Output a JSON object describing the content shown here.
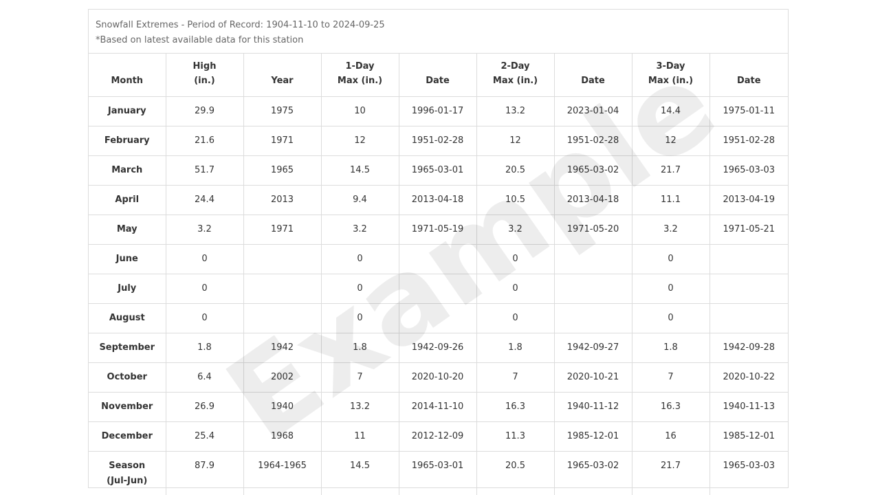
{
  "caption": {
    "title": "Snowfall Extremes - Period of Record: 1904-11-10 to 2024-09-25",
    "note": "*Based on latest available data for this station"
  },
  "watermark": "Example",
  "table": {
    "headers": [
      {
        "line1": "Month",
        "line2": ""
      },
      {
        "line1": "High",
        "line2": "(in.)"
      },
      {
        "line1": "Year",
        "line2": ""
      },
      {
        "line1": "1-Day",
        "line2": "Max (in.)"
      },
      {
        "line1": "Date",
        "line2": ""
      },
      {
        "line1": "2-Day",
        "line2": "Max (in.)"
      },
      {
        "line1": "Date",
        "line2": ""
      },
      {
        "line1": "3-Day",
        "line2": "Max (in.)"
      },
      {
        "line1": "Date",
        "line2": ""
      }
    ],
    "rows": [
      [
        "January",
        "29.9",
        "1975",
        "10",
        "1996-01-17",
        "13.2",
        "2023-01-04",
        "14.4",
        "1975-01-11"
      ],
      [
        "February",
        "21.6",
        "1971",
        "12",
        "1951-02-28",
        "12",
        "1951-02-28",
        "12",
        "1951-02-28"
      ],
      [
        "March",
        "51.7",
        "1965",
        "14.5",
        "1965-03-01",
        "20.5",
        "1965-03-02",
        "21.7",
        "1965-03-03"
      ],
      [
        "April",
        "24.4",
        "2013",
        "9.4",
        "2013-04-18",
        "10.5",
        "2013-04-18",
        "11.1",
        "2013-04-19"
      ],
      [
        "May",
        "3.2",
        "1971",
        "3.2",
        "1971-05-19",
        "3.2",
        "1971-05-20",
        "3.2",
        "1971-05-21"
      ],
      [
        "June",
        "0",
        "",
        "0",
        "",
        "0",
        "",
        "0",
        ""
      ],
      [
        "July",
        "0",
        "",
        "0",
        "",
        "0",
        "",
        "0",
        ""
      ],
      [
        "August",
        "0",
        "",
        "0",
        "",
        "0",
        "",
        "0",
        ""
      ],
      [
        "September",
        "1.8",
        "1942",
        "1.8",
        "1942-09-26",
        "1.8",
        "1942-09-27",
        "1.8",
        "1942-09-28"
      ],
      [
        "October",
        "6.4",
        "2002",
        "7",
        "2020-10-20",
        "7",
        "2020-10-21",
        "7",
        "2020-10-22"
      ],
      [
        "November",
        "26.9",
        "1940",
        "13.2",
        "2014-11-10",
        "16.3",
        "1940-11-12",
        "16.3",
        "1940-11-13"
      ],
      [
        "December",
        "25.4",
        "1968",
        "11",
        "2012-12-09",
        "11.3",
        "1985-12-01",
        "16",
        "1985-12-01"
      ]
    ],
    "season_row": {
      "month_line1": "Season",
      "month_line2": "(Jul-Jun)",
      "cells": [
        "87.9",
        "1964-1965",
        "14.5",
        "1965-03-01",
        "20.5",
        "1965-03-02",
        "21.7",
        "1965-03-03"
      ]
    }
  }
}
